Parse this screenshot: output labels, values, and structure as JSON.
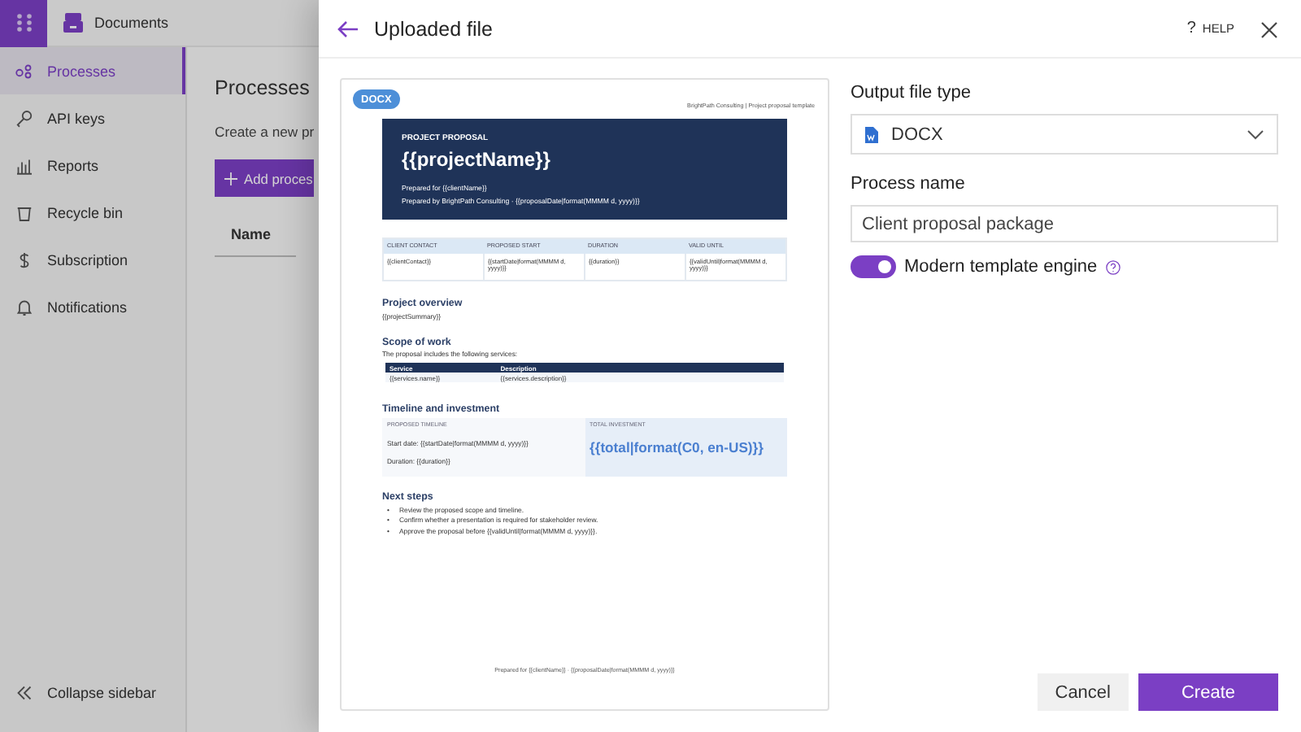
{
  "app_bar": {
    "title": "Documents"
  },
  "sidebar": {
    "items": [
      {
        "label": "Processes",
        "selected": true
      },
      {
        "label": "API keys",
        "selected": false
      },
      {
        "label": "Reports",
        "selected": false
      },
      {
        "label": "Recycle bin",
        "selected": false
      },
      {
        "label": "Subscription",
        "selected": false
      },
      {
        "label": "Notifications",
        "selected": false
      }
    ],
    "collapse": "Collapse sidebar"
  },
  "main": {
    "title": "Processes",
    "description": "Create a new pr",
    "add_button": "Add proces",
    "table": {
      "columns": [
        "Name"
      ]
    }
  },
  "panel": {
    "title": "Uploaded file",
    "help_icon": "?",
    "help": "HELP",
    "preview": {
      "badge": "DOCX",
      "header_note": "BrightPath Consulting | Project proposal template",
      "hero": {
        "eyebrow": "PROJECT PROPOSAL",
        "title": "{{projectName}}",
        "prepared_for": "Prepared for {{clientName}}",
        "prepared_by": "Prepared by BrightPath Consulting · {{proposalDate|format(MMMM d, yyyy)}}"
      },
      "summary_table": {
        "columns": [
          "CLIENT CONTACT",
          "PROPOSED START",
          "DURATION",
          "VALID UNTIL"
        ],
        "rows": [
          [
            "{{clientContact}}",
            "{{startDate|format(MMMM d, yyyy)}}",
            "{{duration}}",
            "{{validUntil|format(MMMM d, yyyy)}}"
          ]
        ]
      },
      "overview": {
        "heading": "Project overview",
        "text": "{{projectSummary}}"
      },
      "scope": {
        "heading": "Scope of work",
        "text": "The proposal includes the following services:",
        "columns": [
          "Service",
          "Description"
        ],
        "rows": [
          [
            "{{services.name}}",
            "{{services.description}}"
          ]
        ]
      },
      "timeline": {
        "heading": "Timeline and investment",
        "timeline_label": "PROPOSED TIMELINE",
        "lines": [
          "Start date: {{startDate|format(MMMM d, yyyy)}}",
          "Duration: {{duration}}"
        ],
        "investment_label": "TOTAL INVESTMENT",
        "investment_value": "{{total|format(C0, en-US)}}"
      },
      "next_steps": {
        "heading": "Next steps",
        "bullet": "•",
        "items": [
          "Review the proposed scope and timeline.",
          "Confirm whether a presentation is required for stakeholder review.",
          "Approve the proposal before {{validUntil|format(MMMM d, yyyy)}}."
        ]
      },
      "footer": "Prepared for {{clientName}} · {{proposalDate|format(MMMM d, yyyy)}}"
    },
    "form": {
      "output_type": {
        "label": "Output file type",
        "value": "DOCX"
      },
      "process_name": {
        "label": "Process name",
        "value": "Client proposal package"
      },
      "toggle": {
        "label": "Modern template engine",
        "on": true
      }
    },
    "buttons": {
      "cancel": "Cancel",
      "create": "Create"
    }
  }
}
